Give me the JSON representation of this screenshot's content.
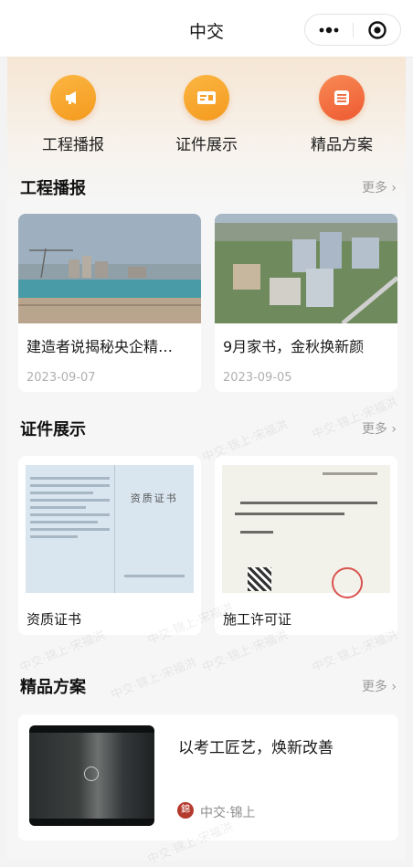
{
  "navbar": {
    "title": "中交"
  },
  "quick_links": [
    {
      "label": "工程播报",
      "icon": "megaphone-icon"
    },
    {
      "label": "证件展示",
      "icon": "id-card-icon"
    },
    {
      "label": "精品方案",
      "icon": "list-icon"
    }
  ],
  "sections": {
    "news": {
      "title": "工程播报",
      "more": "更多",
      "items": [
        {
          "title": "建造者说揭秘央企精…",
          "date": "2023-09-07"
        },
        {
          "title": "9月家书，金秋换新颜",
          "date": "2023-09-05"
        }
      ]
    },
    "certs": {
      "title": "证件展示",
      "more": "更多",
      "items": [
        {
          "title": "资质证书",
          "doc_heading": "资质证书"
        },
        {
          "title": "施工许可证"
        }
      ]
    },
    "plans": {
      "title": "精品方案",
      "more": "更多",
      "item": {
        "title": "以考工匠艺，焕新改善",
        "author": "中交·锦上"
      }
    }
  },
  "watermark_text": "中交·锦上·宋福洪",
  "colors": {
    "accent_orange": "#f6a02a",
    "accent_red": "#f0663a",
    "bg": "#f6f6f6"
  }
}
